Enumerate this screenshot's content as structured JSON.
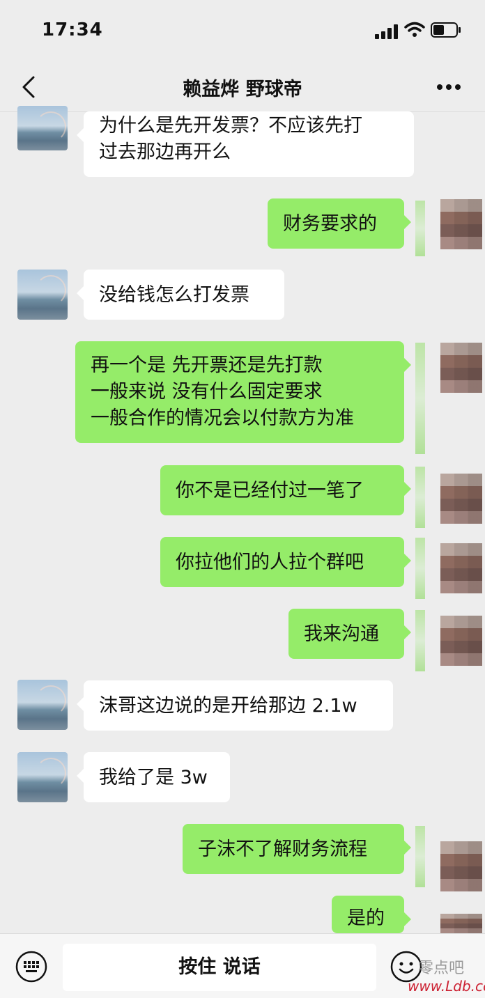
{
  "status_bar": {
    "time": "17:34"
  },
  "nav": {
    "title": "赖益烨 野球帝"
  },
  "messages": [
    {
      "side": "left",
      "lines": [
        "为什么是先开发票？不应该先打",
        "过去那边再开么"
      ]
    },
    {
      "side": "right",
      "lines": [
        "财务要求的"
      ]
    },
    {
      "side": "left",
      "lines": [
        "没给钱怎么打发票"
      ]
    },
    {
      "side": "right",
      "lines": [
        "再一个是 先开票还是先打款",
        "一般来说 没有什么固定要求",
        "一般合作的情况会以付款方为准"
      ]
    },
    {
      "side": "right",
      "lines": [
        "你不是已经付过一笔了"
      ]
    },
    {
      "side": "right",
      "lines": [
        "你拉他们的人拉个群吧"
      ]
    },
    {
      "side": "right",
      "lines": [
        "我来沟通"
      ]
    },
    {
      "side": "left",
      "lines": [
        "沫哥这边说的是开给那边 2.1w"
      ]
    },
    {
      "side": "left",
      "lines": [
        "我给了是 3w"
      ]
    },
    {
      "side": "right",
      "lines": [
        "子沫不了解财务流程"
      ]
    },
    {
      "side": "right",
      "lines": [
        "是的"
      ]
    }
  ],
  "input_bar": {
    "voice_label": "按住 说话"
  },
  "watermark": {
    "cn": "零点吧",
    "url": "www.Ldb.cc"
  },
  "colors": {
    "background": "#ededed",
    "bubble_self": "#95ec69",
    "bubble_other": "#ffffff"
  },
  "icons": [
    "back-icon",
    "more-icon",
    "keyboard-icon",
    "emoji-icon",
    "signal-icon",
    "wifi-icon",
    "battery-icon"
  ]
}
